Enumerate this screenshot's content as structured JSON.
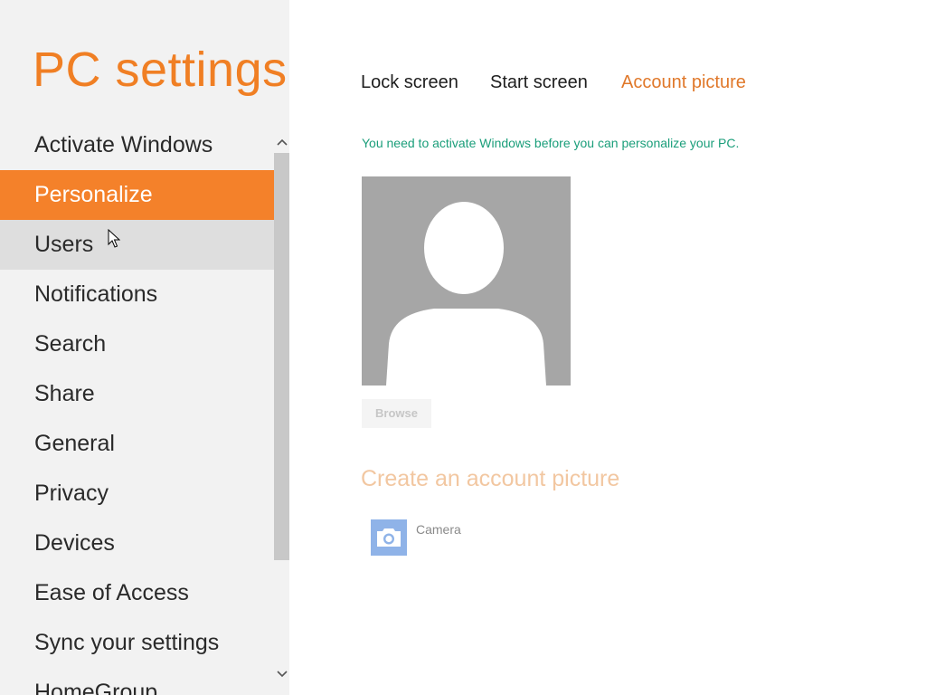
{
  "app": {
    "title": "PC settings"
  },
  "sidebar": {
    "items": [
      {
        "label": "Activate Windows",
        "state": "normal"
      },
      {
        "label": "Personalize",
        "state": "selected"
      },
      {
        "label": "Users",
        "state": "hover"
      },
      {
        "label": "Notifications",
        "state": "normal"
      },
      {
        "label": "Search",
        "state": "normal"
      },
      {
        "label": "Share",
        "state": "normal"
      },
      {
        "label": "General",
        "state": "normal"
      },
      {
        "label": "Privacy",
        "state": "normal"
      },
      {
        "label": "Devices",
        "state": "normal"
      },
      {
        "label": "Ease of Access",
        "state": "normal"
      },
      {
        "label": "Sync your settings",
        "state": "normal"
      },
      {
        "label": "HomeGroup",
        "state": "normal"
      }
    ],
    "scroll_up_icon": "chevron-up-icon",
    "scroll_down_icon": "chevron-down-icon"
  },
  "main": {
    "tabs": [
      {
        "label": "Lock screen",
        "active": false
      },
      {
        "label": "Start screen",
        "active": false
      },
      {
        "label": "Account picture",
        "active": true
      }
    ],
    "activation_message": "You need to activate Windows before you can personalize your PC.",
    "account_picture_icon": "default-user-silhouette-icon",
    "browse_label": "Browse",
    "browse_enabled": false,
    "create_heading": "Create an account picture",
    "apps": [
      {
        "label": "Camera",
        "icon": "camera-icon"
      }
    ]
  },
  "colors": {
    "accent": "#f4812a",
    "title_orange": "#f07f24",
    "message_green": "#1a9e7a",
    "camera_tile": "#8fb3e8"
  }
}
